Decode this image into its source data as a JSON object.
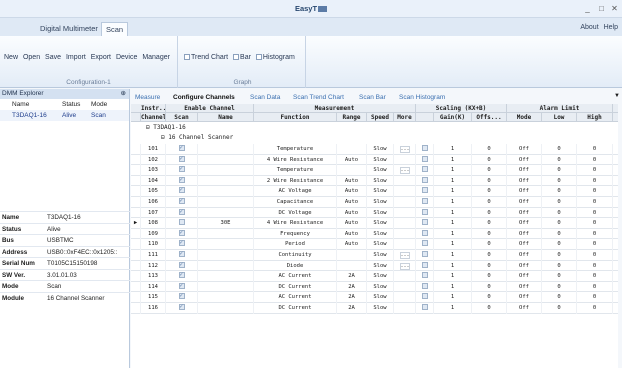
{
  "window": {
    "title": "EasyT",
    "minimize": "_",
    "maximize": "□",
    "close": "✕"
  },
  "ribbon_tabs": [
    "Digital Multimeter",
    "Scan"
  ],
  "help_links": [
    "About",
    "Help"
  ],
  "ribbon": {
    "configuration": {
      "items": [
        "New",
        "Open",
        "Save",
        "Import",
        "Export",
        "Device",
        "Manager"
      ],
      "group": "Configuration-1"
    },
    "graph": {
      "items": [
        "Trend Chart",
        "Bar",
        "Histogram"
      ],
      "group": "Graph"
    }
  },
  "explorer": {
    "title": "DMM Explorer",
    "pin": "⊕",
    "columns": [
      "Name",
      "Status",
      "Mode"
    ],
    "row": {
      "name": "T3DAQ1-16",
      "status": "Alive",
      "mode": "Scan"
    }
  },
  "properties": [
    {
      "key": "Name",
      "value": "T3DAQ1-16"
    },
    {
      "key": "Status",
      "value": "Alive"
    },
    {
      "key": "Bus",
      "value": "USBTMC"
    },
    {
      "key": "Address",
      "value": "USB0::0xF4EC::0x1205::"
    },
    {
      "key": "Serial Num",
      "value": "T0105C15150198"
    },
    {
      "key": "SW Ver.",
      "value": "3.01.01.03"
    },
    {
      "key": "Mode",
      "value": "Scan"
    },
    {
      "key": "Module",
      "value": "16 Channel Scanner"
    }
  ],
  "subtabs": [
    "Measure",
    "Configure Channels",
    "Scan Data",
    "Scan Trend Chart",
    "Scan Bar",
    "Scan Histogram"
  ],
  "subtabs_more": "▼",
  "grid": {
    "group_headers": [
      "Instr...",
      "Enable Channel",
      "Measurement",
      "Scaling (KX+B)",
      "Alarm Limit"
    ],
    "columns": [
      "Channel",
      "Scan",
      "Name",
      "Function",
      "Range",
      "Speed",
      "More",
      "",
      "Gain(K)",
      "Offs...",
      "Mode",
      "Low",
      "High"
    ],
    "tree_root": "⊟ T3DAQ1-16",
    "tree_child": "⊟ 16 Channel Scanner",
    "rows": [
      {
        "ch": "101",
        "name": "",
        "fn": "Temperature",
        "range": "",
        "speed": "Slow",
        "more": true,
        "gain": "1",
        "offset": "0",
        "mode": "Off",
        "low": "0",
        "high": "0"
      },
      {
        "ch": "102",
        "name": "",
        "fn": "4 Wire Resistance",
        "range": "Auto",
        "speed": "Slow",
        "more": false,
        "gain": "1",
        "offset": "0",
        "mode": "Off",
        "low": "0",
        "high": "0"
      },
      {
        "ch": "103",
        "name": "",
        "fn": "Temperature",
        "range": "",
        "speed": "Slow",
        "more": true,
        "gain": "1",
        "offset": "0",
        "mode": "Off",
        "low": "0",
        "high": "0"
      },
      {
        "ch": "104",
        "name": "",
        "fn": "2 Wire Resistance",
        "range": "Auto",
        "speed": "Slow",
        "more": false,
        "gain": "1",
        "offset": "0",
        "mode": "Off",
        "low": "0",
        "high": "0"
      },
      {
        "ch": "105",
        "name": "",
        "fn": "AC Voltage",
        "range": "Auto",
        "speed": "Slow",
        "more": false,
        "gain": "1",
        "offset": "0",
        "mode": "Off",
        "low": "0",
        "high": "0"
      },
      {
        "ch": "106",
        "name": "",
        "fn": "Capacitance",
        "range": "Auto",
        "speed": "Slow",
        "more": false,
        "gain": "1",
        "offset": "0",
        "mode": "Off",
        "low": "0",
        "high": "0"
      },
      {
        "ch": "107",
        "name": "",
        "fn": "DC Voltage",
        "range": "Auto",
        "speed": "Slow",
        "more": false,
        "gain": "1",
        "offset": "0",
        "mode": "Off",
        "low": "0",
        "high": "0"
      },
      {
        "ch": "108",
        "name": "30E",
        "fn": "4 Wire Resistance",
        "range": "Auto",
        "speed": "Slow",
        "more": false,
        "gain": "1",
        "offset": "0",
        "mode": "Off",
        "low": "0",
        "high": "0"
      },
      {
        "ch": "109",
        "name": "",
        "fn": "Frequency",
        "range": "Auto",
        "speed": "Slow",
        "more": false,
        "gain": "1",
        "offset": "0",
        "mode": "Off",
        "low": "0",
        "high": "0"
      },
      {
        "ch": "110",
        "name": "",
        "fn": "Period",
        "range": "Auto",
        "speed": "Slow",
        "more": false,
        "gain": "1",
        "offset": "0",
        "mode": "Off",
        "low": "0",
        "high": "0"
      },
      {
        "ch": "111",
        "name": "",
        "fn": "Continuity",
        "range": "",
        "speed": "Slow",
        "more": true,
        "gain": "1",
        "offset": "0",
        "mode": "Off",
        "low": "0",
        "high": "0"
      },
      {
        "ch": "112",
        "name": "",
        "fn": "Diode",
        "range": "",
        "speed": "Slow",
        "more": true,
        "gain": "1",
        "offset": "0",
        "mode": "Off",
        "low": "0",
        "high": "0"
      },
      {
        "ch": "113",
        "name": "",
        "fn": "AC Current",
        "range": "2A",
        "speed": "Slow",
        "more": false,
        "gain": "1",
        "offset": "0",
        "mode": "Off",
        "low": "0",
        "high": "0"
      },
      {
        "ch": "114",
        "name": "",
        "fn": "DC Current",
        "range": "2A",
        "speed": "Slow",
        "more": false,
        "gain": "1",
        "offset": "0",
        "mode": "Off",
        "low": "0",
        "high": "0"
      },
      {
        "ch": "115",
        "name": "",
        "fn": "AC Current",
        "range": "2A",
        "speed": "Slow",
        "more": false,
        "gain": "1",
        "offset": "0",
        "mode": "Off",
        "low": "0",
        "high": "0"
      },
      {
        "ch": "116",
        "name": "",
        "fn": "DC Current",
        "range": "2A",
        "speed": "Slow",
        "more": false,
        "gain": "1",
        "offset": "0",
        "mode": "Off",
        "low": "0",
        "high": "0"
      }
    ]
  }
}
